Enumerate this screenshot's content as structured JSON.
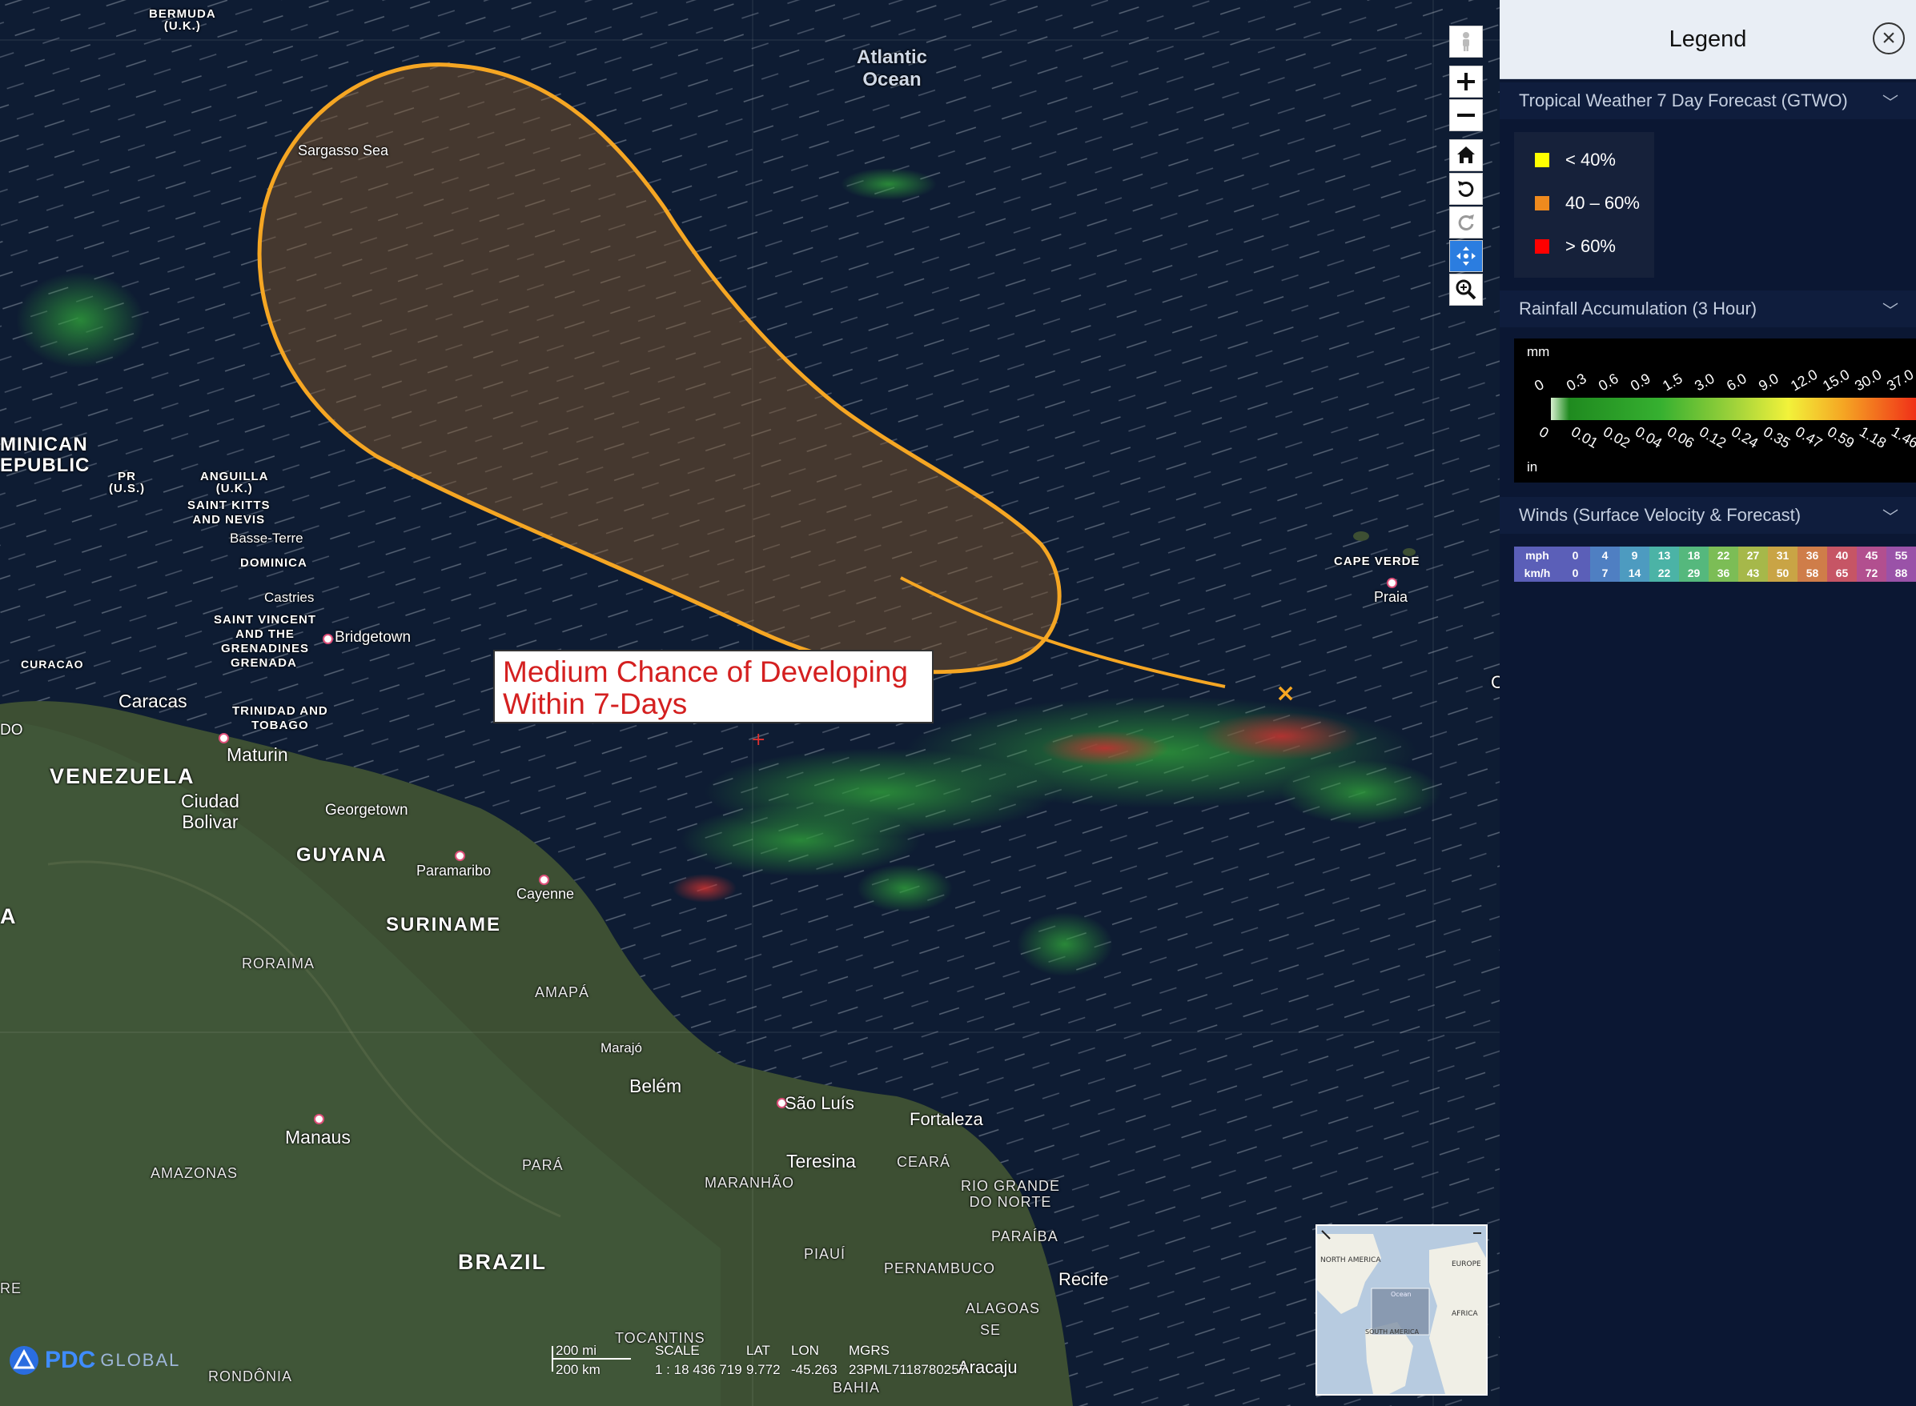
{
  "map": {
    "callout": {
      "line1": "Medium Chance of Developing",
      "line2": "Within 7-Days"
    },
    "labels": {
      "bermuda": "BERMUDA\n(U.K.)",
      "atlantic": "Atlantic\nOcean",
      "sargasso": "Sargasso Sea",
      "dominican": "MINICAN\nEPUBLIC",
      "pr": "PR\n(U.S.)",
      "anguilla": "ANGUILLA\n(U.K.)",
      "stkitts": "SAINT KITTS\nAND NEVIS",
      "basse_terre": "Basse-Terre",
      "dominica": "DOMINICA",
      "castries": "Castries",
      "stvincent": "SAINT VINCENT\nAND THE\nGRENADINES",
      "bridgetown": "Bridgetown",
      "grenada": "GRENADA",
      "curacao": "CURACAO",
      "caracas": "Caracas",
      "trinidad": "TRINIDAD AND\nTOBAGO",
      "do": "DO",
      "maturin": "Maturin",
      "venezuela": "VENEZUELA",
      "ciudad_bolivar": "Ciudad\nBolivar",
      "georgetown": "Georgetown",
      "guyana": "GUYANA",
      "paramaribo": "Paramaribo",
      "cayenne": "Cayenne",
      "suriname": "SURINAME",
      "roraima": "RORAIMA",
      "amapa": "AMAPÁ",
      "a_edge": "A",
      "marajo": "Marajó",
      "belem": "Belém",
      "sao_luis": "São Luís",
      "fortaleza": "Fortaleza",
      "manaus": "Manaus",
      "amazonas": "AMAZONAS",
      "para": "PARÁ",
      "teresina": "Teresina",
      "ceara": "CEARÁ",
      "maranhao": "MARANHÃO",
      "rio_grande": "RIO GRANDE\nDO NORTE",
      "paraiba": "PARAÍBA",
      "brazil": "BRAZIL",
      "piaui": "PIAUÍ",
      "pernambuco": "PERNAMBUCO",
      "recife": "Recife",
      "alagoas": "ALAGOAS",
      "se": "SE",
      "aracaju": "Aracaju",
      "tocantins": "TOCANTINS",
      "bahia": "BAHIA",
      "rondonia": "RONDÔNIA",
      "re": "RE",
      "cape_verde": "CAPE VERDE",
      "praia": "Praia",
      "edge_c": "C"
    },
    "scale": {
      "mi": "200 mi",
      "km": "200 km",
      "scale_label": "SCALE",
      "scale_value": "1 : 18 436 719",
      "lat_label": "LAT",
      "lat_value": "9.772",
      "lon_label": "LON",
      "lon_value": "-45.263",
      "mgrs_label": "MGRS",
      "mgrs_value": "23PML7118780257"
    },
    "logo": {
      "pdc": "PDC",
      "global": "GLOBAL"
    },
    "minimap": {
      "na": "NORTH AMERICA",
      "europe": "EUROPE",
      "africa": "AFRICA",
      "sa": "SOUTH AMERICA",
      "ocean": "Ocean"
    }
  },
  "toolbar": {
    "buttons": [
      "person-icon",
      "zoom-in-icon",
      "zoom-out-icon",
      "home-icon",
      "rotate-left-icon",
      "rotate-right-icon",
      "pan-icon",
      "zoom-region-icon"
    ]
  },
  "legend": {
    "title": "Legend",
    "sections": [
      {
        "title": "Tropical Weather 7 Day Forecast (GTWO)"
      },
      {
        "title": "Rainfall Accumulation (3 Hour)"
      },
      {
        "title": "Winds (Surface Velocity & Forecast)"
      }
    ],
    "gtwo": [
      {
        "label": "< 40%",
        "color": "#ffff00"
      },
      {
        "label": "40 – 60%",
        "color": "#ef8a1e"
      },
      {
        "label": "> 60%",
        "color": "#ff0000"
      }
    ],
    "rain": {
      "mm_label": "mm",
      "in_label": "in",
      "mm_values": [
        "0",
        "0.3",
        "0.6",
        "0.9",
        "1.5",
        "3.0",
        "6.0",
        "9.0",
        "12.0",
        "15.0",
        "30.0",
        "37.0"
      ],
      "in_values": [
        "0",
        "0.01",
        "0.02",
        "0.04",
        "0.06",
        "0.12",
        "0.24",
        "0.35",
        "0.47",
        "0.59",
        "1.18",
        "1.46"
      ]
    },
    "winds": {
      "mph_label": "mph",
      "kmh_label": "km/h",
      "mph": [
        "0",
        "4",
        "9",
        "13",
        "18",
        "22",
        "27",
        "31",
        "36",
        "40",
        "45",
        "55"
      ],
      "kmh": [
        "0",
        "7",
        "14",
        "22",
        "29",
        "36",
        "43",
        "50",
        "58",
        "65",
        "72",
        "88"
      ],
      "colors": [
        "#5b5fb8",
        "#4f7fc2",
        "#4d9bc0",
        "#4bb3a6",
        "#55b87d",
        "#7cbd56",
        "#a6b84a",
        "#c9a445",
        "#cf7d49",
        "#c65565",
        "#b24f8f",
        "#9a52a8"
      ]
    }
  }
}
